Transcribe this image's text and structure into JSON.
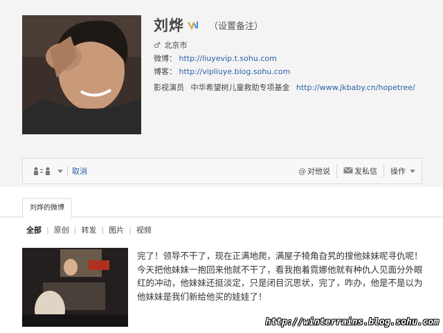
{
  "profile": {
    "name": "刘烨",
    "remark": "（设置备注）",
    "location": "北京市",
    "weibo_label": "微博：",
    "weibo_url": "http://liuyevip.t.sohu.com",
    "blog_label": "博客：",
    "blog_url": "http://vipliuye.blog.sohu.com",
    "desc_role": "影视演员",
    "desc_fund": "中华希望树儿童救助专项基金",
    "desc_url": "http://www.jkbaby.cn/hopetree/"
  },
  "toolbar": {
    "cancel_label": "取消",
    "at_label": "对他说",
    "message_label": "发私信",
    "action_label": "操作"
  },
  "tabs": [
    {
      "label": "刘烨的微博"
    }
  ],
  "filters": [
    {
      "label": "全部"
    },
    {
      "label": "原创"
    },
    {
      "label": "转发"
    },
    {
      "label": "图片"
    },
    {
      "label": "视频"
    }
  ],
  "post": {
    "text": "完了！领导不干了，现在正满地爬，满屋子犄角旮旯的搜他妹妹呢寻仇呢！今天把他妹妹一抱回来他就不干了，看我抱着霓娜他就有种仇人见面分外眼红的冲动，他妹妹还挺淡定，只是闭目沉思状，完了，咋办，他是不是以为他妹妹是我们新给他买的娃娃了！"
  },
  "watermark": "http://winterrains.blog.sohu.com",
  "colors": {
    "link": "#2a5ea8",
    "background_top": "#f4f4f4",
    "vip_badge": "#d9a441"
  }
}
